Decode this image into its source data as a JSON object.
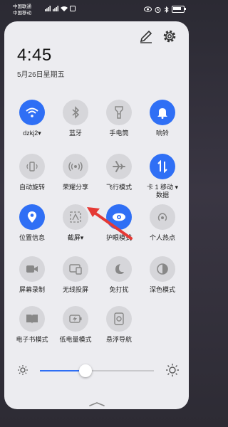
{
  "status_bar": {
    "carrier1": "中国联通",
    "carrier2": "中国移动",
    "carrier1_tag": "HD",
    "carrier2_tag": "HD"
  },
  "header": {
    "time": "4:45",
    "date": "5月26日星期五"
  },
  "tiles": [
    {
      "label": "dzkj2▾",
      "icon": "wifi-icon",
      "active": true
    },
    {
      "label": "蓝牙",
      "icon": "bluetooth-icon",
      "active": false
    },
    {
      "label": "手电筒",
      "icon": "flashlight-icon",
      "active": false
    },
    {
      "label": "响铃",
      "icon": "bell-icon",
      "active": true
    },
    {
      "label": "自动旋转",
      "icon": "rotate-icon",
      "active": false
    },
    {
      "label": "荣耀分享",
      "icon": "share-icon",
      "active": false
    },
    {
      "label": "飞行模式",
      "icon": "airplane-icon",
      "active": false
    },
    {
      "label": "卡 1 移动 ▾",
      "label2": "数据",
      "icon": "mobile-data-icon",
      "active": true
    },
    {
      "label": "位置信息",
      "icon": "location-icon",
      "active": true
    },
    {
      "label": "截屏▾",
      "icon": "screenshot-icon",
      "active": false
    },
    {
      "label": "护眼模式",
      "icon": "eye-icon",
      "active": true
    },
    {
      "label": "个人热点",
      "icon": "hotspot-icon",
      "active": false
    },
    {
      "label": "屏幕录制",
      "icon": "screen-record-icon",
      "active": false
    },
    {
      "label": "无线投屏",
      "icon": "wireless-projection-icon",
      "active": false
    },
    {
      "label": "免打扰",
      "icon": "moon-icon",
      "active": false
    },
    {
      "label": "深色模式",
      "icon": "dark-mode-icon",
      "active": false
    },
    {
      "label": "电子书模式",
      "icon": "ebook-icon",
      "active": false
    },
    {
      "label": "低电量模式",
      "icon": "low-battery-icon",
      "active": false
    },
    {
      "label": "悬浮导航",
      "icon": "floating-nav-icon",
      "active": false
    }
  ],
  "brightness": {
    "level": 0.4
  },
  "colors": {
    "accent": "#2f6ff5",
    "annotation_arrow": "#e53935"
  }
}
